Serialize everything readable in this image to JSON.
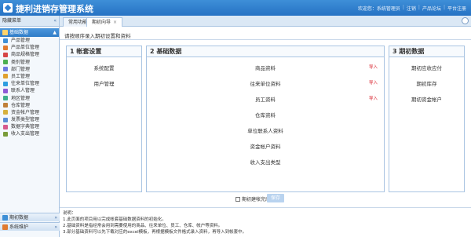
{
  "header": {
    "title": "捷利进销存管理系统",
    "welcome": "欢迎您：系统管理员",
    "logout": "注销",
    "forum": "产品论坛",
    "register": "平台注册"
  },
  "tabs": [
    {
      "label": "常用功能"
    },
    {
      "label": "期初向导",
      "close": "×"
    }
  ],
  "sidebar": {
    "title": "隐藏菜单",
    "collapse": "«",
    "group": {
      "label": "基础数据",
      "arrow": "▲"
    },
    "items": [
      {
        "label": "产品管理",
        "color": "#3d8fd6"
      },
      {
        "label": "产品单位管理",
        "color": "#e07a2f"
      },
      {
        "label": "商品规格管理",
        "color": "#d64545"
      },
      {
        "label": "类别管理",
        "color": "#4caf50"
      },
      {
        "label": "部门管理",
        "color": "#6c7ae0"
      },
      {
        "label": "员工管理",
        "color": "#e0a02f"
      },
      {
        "label": "往来单位管理",
        "color": "#2f9ee0"
      },
      {
        "label": "联系人管理",
        "color": "#8e5ad6"
      },
      {
        "label": "地区管理",
        "color": "#3fae8c"
      },
      {
        "label": "仓库管理",
        "color": "#c0803a"
      },
      {
        "label": "资金帐户管理",
        "color": "#d6b13d"
      },
      {
        "label": "发票类型管理",
        "color": "#5a8fd6"
      },
      {
        "label": "数据字典管理",
        "color": "#d65a8e"
      },
      {
        "label": "收入支出管理",
        "color": "#7a9c3a"
      }
    ],
    "bottom": [
      {
        "label": "期初数据",
        "arrow": "»",
        "color": "#3d8fd6"
      },
      {
        "label": "系统维护",
        "arrow": "»",
        "color": "#e07a2f"
      }
    ]
  },
  "main": {
    "hint": "请按顺序录入期初设置和资料",
    "panels": [
      {
        "title": "1 帐套设置",
        "links": [
          "系统配置",
          "用户管理"
        ]
      },
      {
        "title": "2 基础数据",
        "links": [
          "商品资料",
          "往来单位资料",
          "员工资料",
          "仓库资料",
          "单位联系人资料",
          "资金帐户资料",
          "收入支出类型"
        ]
      },
      {
        "title": "3 期初数据",
        "links": [
          "期初应收应付",
          "期初库存",
          "期初资金帐户"
        ]
      }
    ],
    "import_label": "导入",
    "checkbox_label": "期初建帐完成",
    "save_button": "保存",
    "notes": [
      "说明：",
      "1.此页面的项目用以完成帐套基础数据资料的初始化。",
      "2.基础资料是指经常会用到需要使用的商品、往来单位、员工、仓库、帐户等资料。",
      "3.部分基础资料可以先下载对应的excel模板，再根据模板文件格式录入资料，再导入到帐套中。"
    ]
  },
  "colors": {
    "header": "#2f7fd0",
    "accent": "#a9c4e2",
    "import": "#d9232d"
  }
}
